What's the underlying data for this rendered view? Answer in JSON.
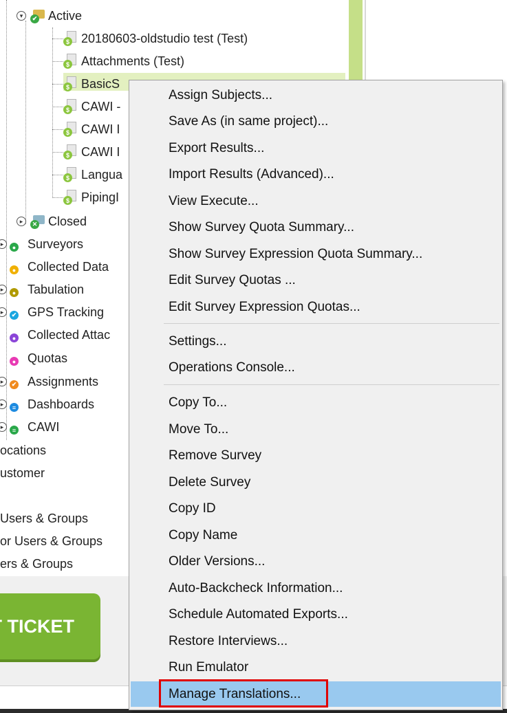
{
  "tree": {
    "active_label": "Active",
    "surveys": [
      {
        "label": "20180603-oldstudio test (Test)"
      },
      {
        "label": "Attachments (Test)"
      },
      {
        "label": "BasicS"
      },
      {
        "label": "CAWI -"
      },
      {
        "label": "CAWI I"
      },
      {
        "label": "CAWI I"
      },
      {
        "label": "Langua"
      },
      {
        "label": "PipingI"
      }
    ],
    "closed_label": "Closed",
    "sections": [
      {
        "label": "Surveyors",
        "icon": "surveyors-icon",
        "color": "#2aa84a"
      },
      {
        "label": "Collected Data",
        "icon": "collected-data-icon",
        "color": "#f0b000"
      },
      {
        "label": "Tabulation",
        "icon": "tabulation-icon",
        "color": "#b09a00"
      },
      {
        "label": "GPS Tracking",
        "icon": "gps-tracking-icon",
        "color": "#19a6e0"
      },
      {
        "label": "Collected Attac",
        "icon": "collected-attachments-icon",
        "color": "#8b45d8"
      },
      {
        "label": "Quotas",
        "icon": "quotas-icon",
        "color": "#e83ab3"
      },
      {
        "label": "Assignments",
        "icon": "assignments-icon",
        "color": "#f08a1e"
      },
      {
        "label": "Dashboards",
        "icon": "dashboards-icon",
        "color": "#1e8be0"
      },
      {
        "label": "CAWI",
        "icon": "cawi-icon",
        "color": "#2aa84a"
      }
    ],
    "roots": [
      {
        "label": "ocations"
      },
      {
        "label": "ustomer"
      }
    ],
    "user_groups": [
      {
        "label": "Users & Groups"
      },
      {
        "label": "or Users & Groups"
      },
      {
        "label": "ers & Groups"
      }
    ]
  },
  "ticket_button": {
    "label": "T TICKET"
  },
  "context_menu": {
    "groups": [
      [
        "Assign Subjects...",
        "Save As (in same project)...",
        "Export Results...",
        "Import Results (Advanced)...",
        "View Execute...",
        "Show Survey Quota Summary...",
        "Show Survey Expression Quota Summary...",
        "Edit Survey Quotas ...",
        "Edit Survey Expression Quotas..."
      ],
      [
        "Settings...",
        "Operations Console..."
      ],
      [
        "Copy To...",
        "Move To...",
        "Remove Survey",
        "Delete Survey",
        "Copy ID",
        "Copy Name",
        "Older Versions...",
        "Auto-Backcheck Information...",
        "Schedule Automated Exports...",
        "Restore Interviews...",
        "Run Emulator",
        "Manage Translations..."
      ]
    ],
    "highlighted_item": "Manage Translations..."
  },
  "colors": {
    "accent_green": "#7ab533",
    "survey_badge": "#8cc63f",
    "menu_highlight": "#99c9ef",
    "annotation_red": "#e00000"
  }
}
